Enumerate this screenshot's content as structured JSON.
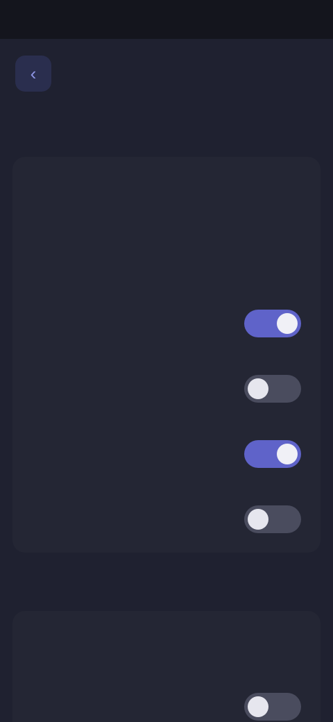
{
  "status_bar": {
    "time": "",
    "icons": ""
  },
  "header": {
    "back_icon": "chevron-left-icon",
    "title": ""
  },
  "section_main": {
    "rows": [
      {
        "title": "",
        "subtitle": ""
      },
      {
        "title": "",
        "subtitle": ""
      },
      {
        "title": "",
        "toggle_on": true
      },
      {
        "title": "",
        "toggle_on": false
      },
      {
        "title": "",
        "toggle_on": true
      },
      {
        "title": "",
        "subtitle": "",
        "toggle_on": false
      }
    ]
  },
  "section_secondary": {
    "label": "",
    "rows": [
      {
        "title": "",
        "subtitle": ""
      },
      {
        "title": "",
        "toggle_on": false
      }
    ]
  },
  "colors": {
    "accent": "#5f63c9",
    "background": "#1f2130",
    "card": "#242634"
  }
}
